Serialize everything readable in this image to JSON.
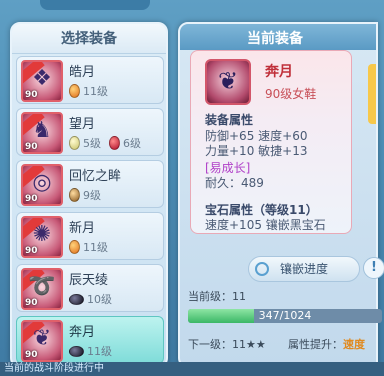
{
  "left_panel": {
    "title": "选择装备",
    "items": [
      {
        "name": "皓月",
        "level": "90",
        "ribbon": "",
        "gems": [
          {
            "color": "orange",
            "text": "11级"
          }
        ]
      },
      {
        "name": "望月",
        "level": "90",
        "ribbon": "",
        "gems": [
          {
            "color": "lime",
            "text": "5级"
          },
          {
            "color": "red",
            "text": "6级"
          }
        ]
      },
      {
        "name": "回忆之眸",
        "level": "90",
        "ribbon": "",
        "gems": [
          {
            "color": "amber",
            "text": "9级"
          }
        ]
      },
      {
        "name": "新月",
        "level": "90",
        "ribbon": "",
        "gems": [
          {
            "color": "orange",
            "text": "11级"
          }
        ]
      },
      {
        "name": "辰天绫",
        "level": "90",
        "ribbon": "",
        "gems": [
          {
            "color": "black",
            "text": "10级"
          }
        ]
      },
      {
        "name": "奔月",
        "level": "90",
        "ribbon": "",
        "gems": [
          {
            "color": "black",
            "text": "11级"
          }
        ]
      }
    ]
  },
  "right_panel": {
    "title": "当前装备",
    "item_name": "奔月",
    "item_sub": "90级女鞋",
    "attr_head": "装备属性",
    "attr_line1": "防御+65 速度+60",
    "attr_line2": "力量+10 敏捷+13",
    "attr_line3": "[易成长]",
    "attr_line4": "耐久：489",
    "gem_head": "宝石属性（等级11）",
    "gem_line": "速度+105 镶嵌黑宝石",
    "inlay_button": "镶嵌进度",
    "info_button": "!",
    "current_level": "当前级：11",
    "exp_text": "347/1024",
    "exp_fraction": 0.339,
    "next_level": "下一级：11★★",
    "attr_up_label": "属性提升：",
    "attr_up_value": "速度"
  },
  "bottom_strip": "当前的战斗阶段进行中"
}
